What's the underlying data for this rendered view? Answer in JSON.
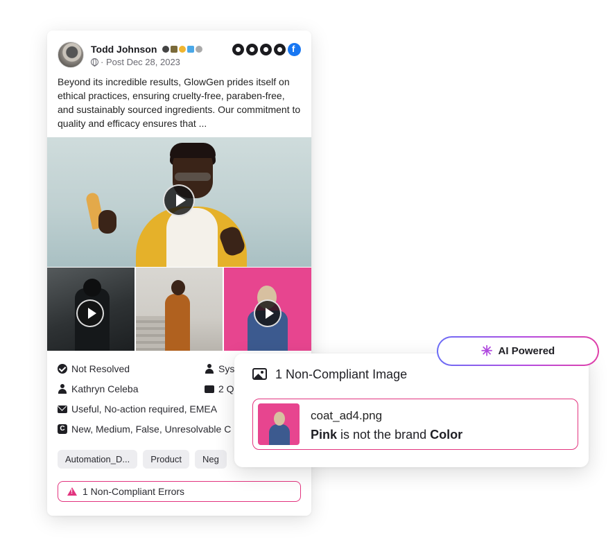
{
  "post": {
    "author": "Todd Johnson",
    "meta": "· Post Dec 28, 2023",
    "text": "Beyond its incredible results, GlowGen prides itself on ethical practices, ensuring cruelty-free, paraben-free, and sustainably sourced ingredients. Our commitment to quality and efficacy ensures that ..."
  },
  "properties": {
    "status": "Not Resolved",
    "sys": "Sys",
    "assignee": "Kathryn Celeba",
    "q": "2 Q",
    "labels": "Useful, No-action required, EMEA",
    "custom": "New, Medium, False, Unresolvable C"
  },
  "tags": [
    "Automation_D...",
    "Product",
    "Neg"
  ],
  "errors": {
    "label": "1 Non-Compliant Errors"
  },
  "compliance": {
    "title": "1 Non-Compliant Image",
    "file": "coat_ad4.png",
    "msg_pre": "Pink",
    "msg_mid": " is not the brand ",
    "msg_post": "Color"
  },
  "ai": {
    "label": "AI Powered"
  },
  "colors": {
    "accent": "#e2337e",
    "ai_gradient_start": "#6a6cf6",
    "ai_gradient_end": "#e040a8",
    "facebook": "#1877f2"
  }
}
